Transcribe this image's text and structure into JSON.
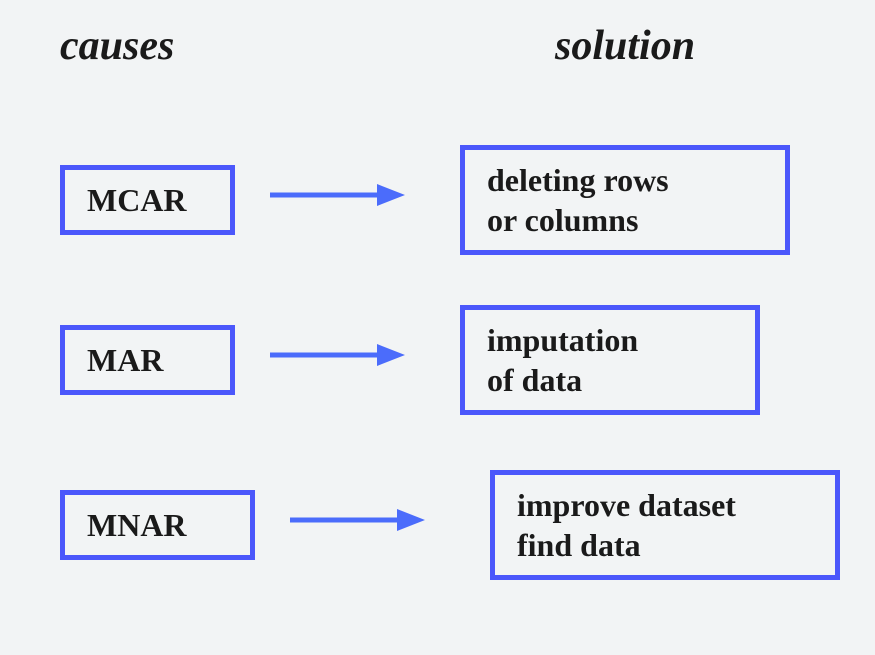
{
  "headers": {
    "causes": "causes",
    "solution": "solution"
  },
  "rows": [
    {
      "cause": "MCAR",
      "solution": "deleting rows\nor columns"
    },
    {
      "cause": "MAR",
      "solution": "imputation\nof data"
    },
    {
      "cause": "MNAR",
      "solution": "improve dataset\nfind data"
    }
  ],
  "colors": {
    "border": "#4b57fb",
    "arrow": "#4b6cfb",
    "background": "#f2f4f5",
    "text": "#1a1a1a"
  }
}
